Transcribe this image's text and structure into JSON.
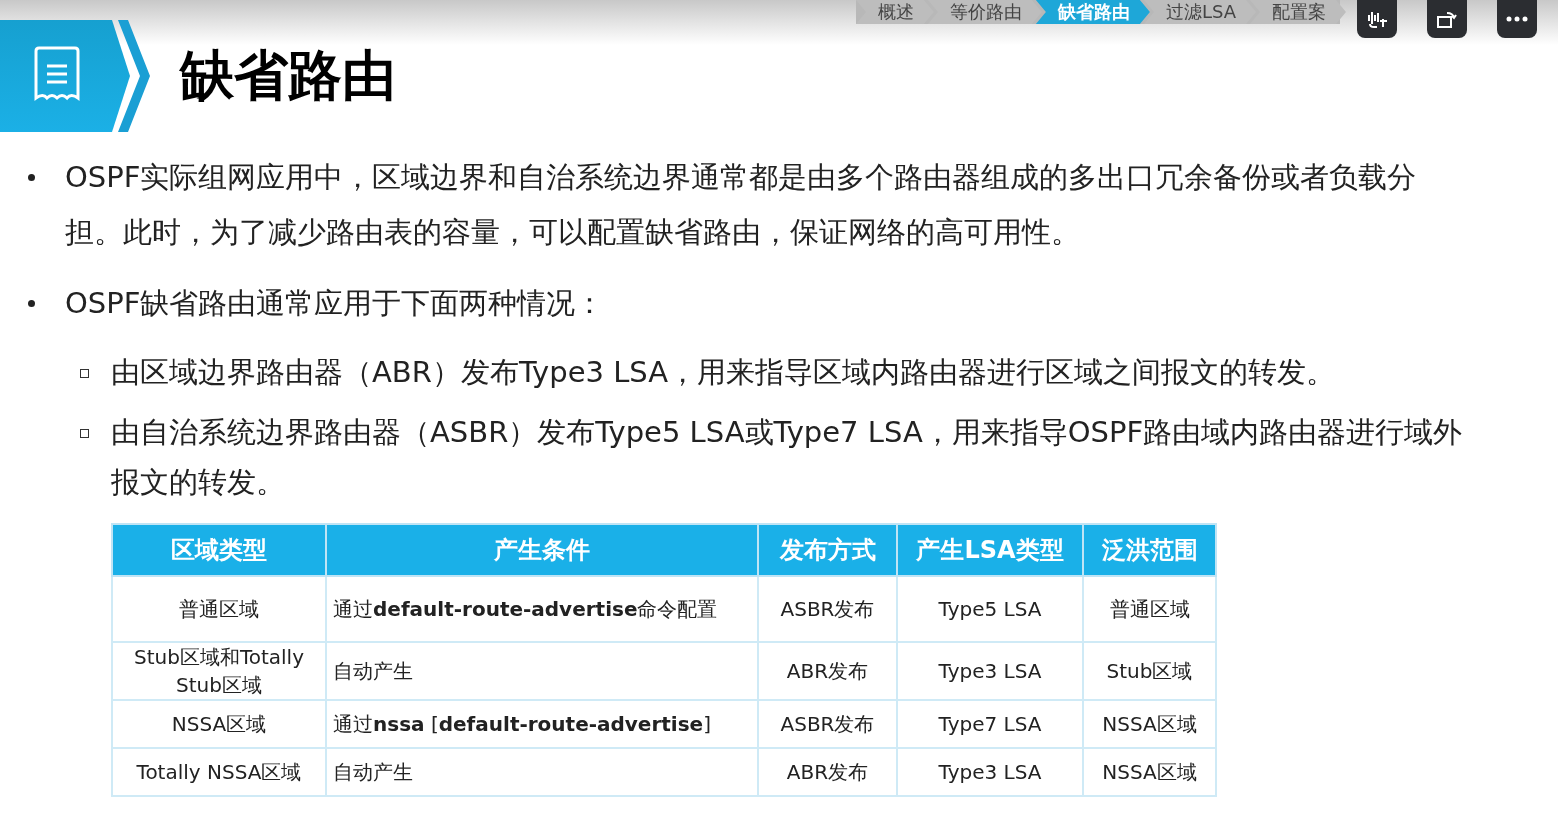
{
  "nav": {
    "items": [
      {
        "label": "概述",
        "selected": false
      },
      {
        "label": "等价路由",
        "selected": false
      },
      {
        "label": "缺省路由",
        "selected": true
      },
      {
        "label": "过滤LSA",
        "selected": false
      },
      {
        "label": "配置案",
        "selected": false
      }
    ]
  },
  "title": "缺省路由",
  "bullets": [
    {
      "text": "OSPF实际组网应用中，区域边界和自治系统边界通常都是由多个路由器组成的多出口冗余备份或者负载分担。此时，为了减少路由表的容量，可以配置缺省路由，保证网络的高可用性。"
    },
    {
      "text": "OSPF缺省路由通常应用于下面两种情况：",
      "children": [
        {
          "text": "由区域边界路由器（ABR）发布Type3 LSA，用来指导区域内路由器进行区域之间报文的转发。"
        },
        {
          "text": "由自治系统边界路由器（ASBR）发布Type5 LSA或Type7 LSA，用来指导OSPF路由域内路由器进行域外报文的转发。"
        }
      ]
    }
  ],
  "table": {
    "columns": [
      "区域类型",
      "产生条件",
      "发布方式",
      "产生LSA类型",
      "泛洪范围"
    ],
    "rows": [
      [
        "普通区域",
        "通过**default-route-advertise**命令配置",
        "ASBR发布",
        "Type5 LSA",
        "普通区域"
      ],
      [
        "Stub区域和Totally Stub区域",
        "自动产生",
        "ABR发布",
        "Type3 LSA",
        "Stub区域"
      ],
      [
        "NSSA区域",
        "通过**nssa** [**default-route-advertise**]",
        "ASBR发布",
        "Type7 LSA",
        "NSSA区域"
      ],
      [
        "Totally NSSA区域",
        "自动产生",
        "ABR发布",
        "Type3 LSA",
        "NSSA区域"
      ]
    ]
  }
}
